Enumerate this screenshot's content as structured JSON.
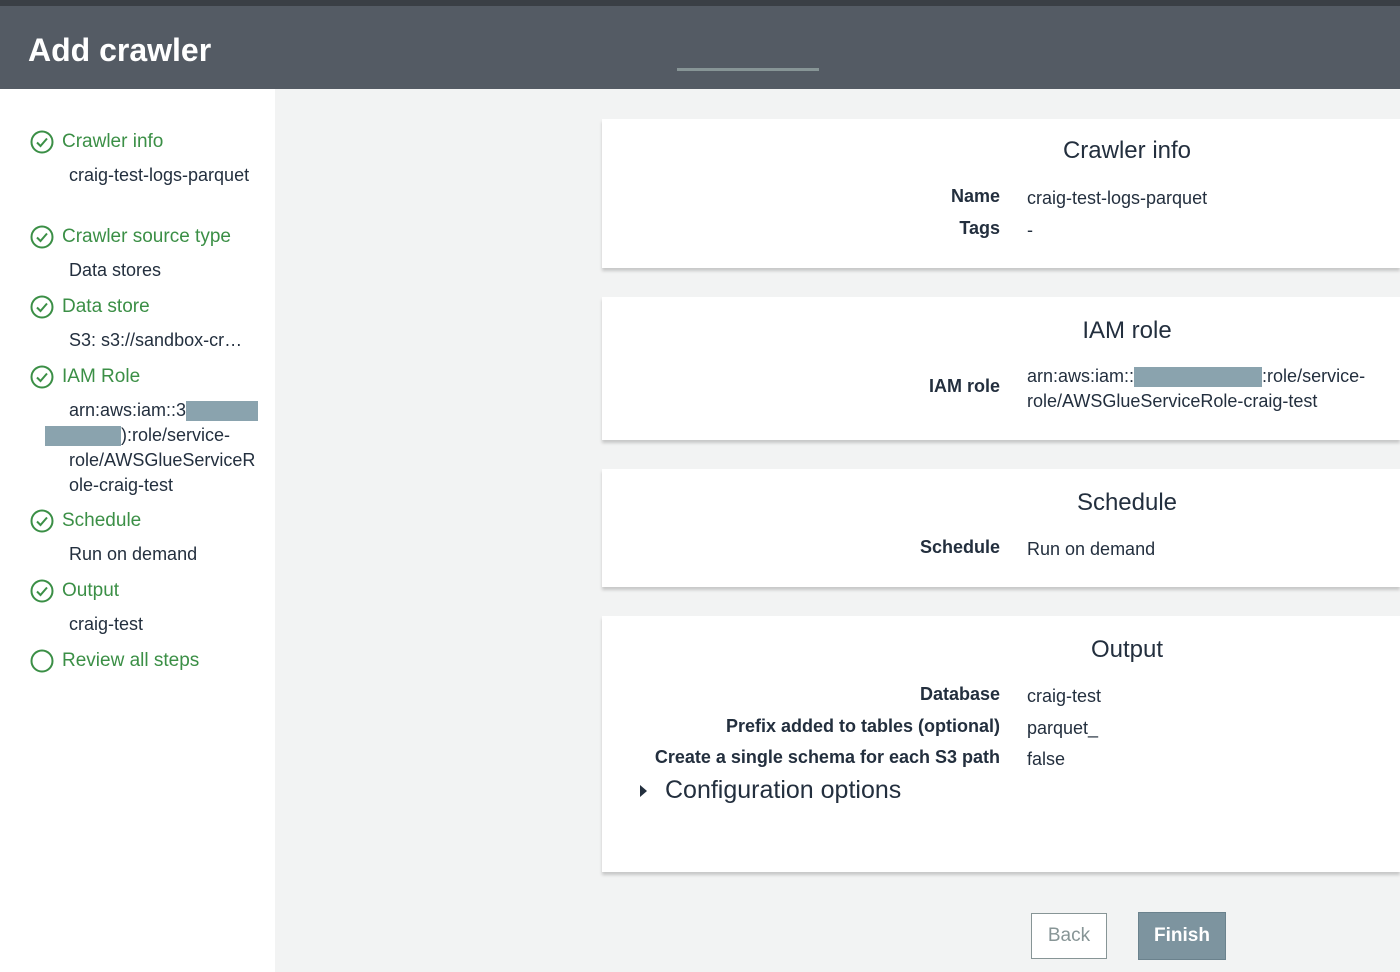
{
  "header": {
    "title": "Add crawler"
  },
  "sidebar": {
    "steps": [
      {
        "title": "Crawler info",
        "detail": "craig-test-logs-parquet",
        "done": true
      },
      {
        "title": "Crawler source type",
        "detail": "Data stores",
        "done": true
      },
      {
        "title": "Data store",
        "detail": "S3: s3://sandbox-cr…",
        "done": true
      },
      {
        "title": "IAM Role",
        "detail_prefix": "arn:aws:iam::3",
        "detail_suffix": "):role/service-role/AWSGlueServiceRole-craig-test",
        "done": true
      },
      {
        "title": "Schedule",
        "detail": "Run on demand",
        "done": true
      },
      {
        "title": "Output",
        "detail": "craig-test",
        "done": true
      },
      {
        "title": "Review all steps",
        "done": false
      }
    ]
  },
  "panels": {
    "crawler_info": {
      "title": "Crawler info",
      "rows": [
        {
          "label": "Name",
          "value": "craig-test-logs-parquet"
        },
        {
          "label": "Tags",
          "value": "-"
        }
      ]
    },
    "iam_role": {
      "title": "IAM role",
      "label": "IAM role",
      "value_prefix": "arn:aws:iam::",
      "value_suffix": ":role/service-role/AWSGlueServiceRole-craig-test"
    },
    "schedule": {
      "title": "Schedule",
      "rows": [
        {
          "label": "Schedule",
          "value": "Run on demand"
        }
      ]
    },
    "output": {
      "title": "Output",
      "rows": [
        {
          "label": "Database",
          "value": "craig-test"
        },
        {
          "label": "Prefix added to tables (optional)",
          "value": "parquet_"
        },
        {
          "label": "Create a single schema for each S3 path",
          "value": "false"
        }
      ],
      "config_label": "Configuration options"
    }
  },
  "buttons": {
    "back": "Back",
    "finish": "Finish"
  },
  "colors": {
    "header_bg": "#545b64",
    "step_green": "#3b8f46",
    "finish_bg": "#7d949f"
  }
}
